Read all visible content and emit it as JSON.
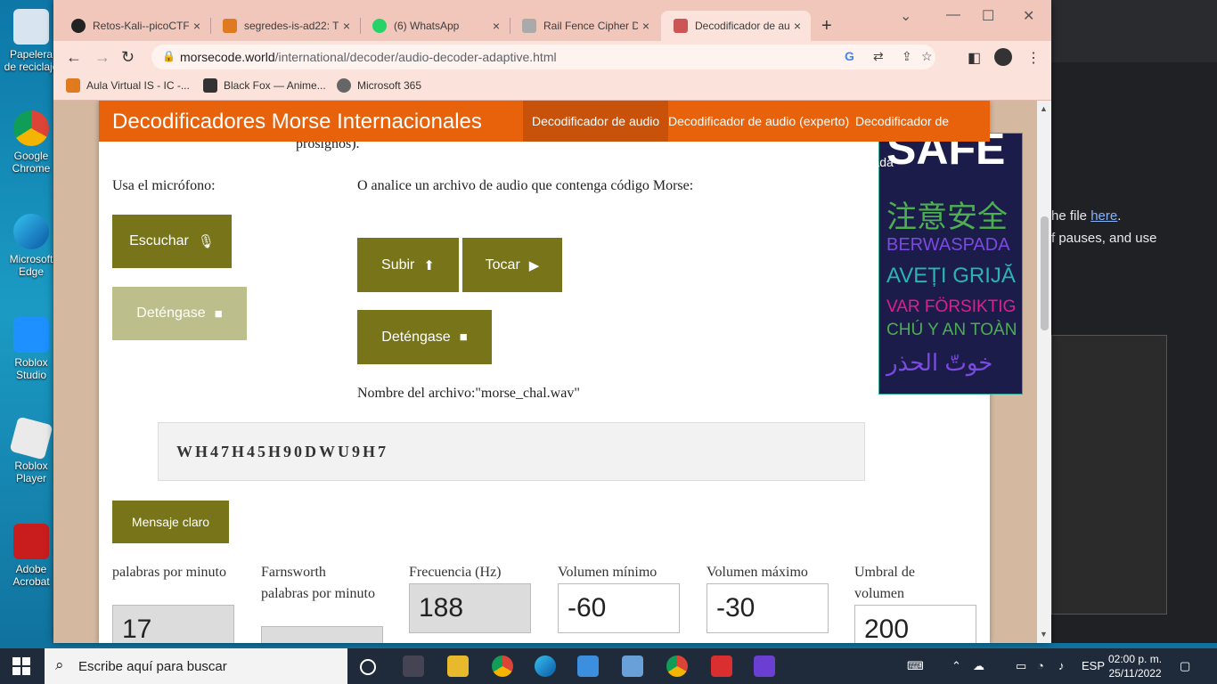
{
  "desktop": {
    "icons": [
      {
        "label": "Papelera de reciclaje"
      },
      {
        "label": "Google Chrome"
      },
      {
        "label": "Microsoft Edge"
      },
      {
        "label": "Roblox Studio"
      },
      {
        "label": "Roblox Player"
      },
      {
        "label": "Adobe Acrobat"
      }
    ]
  },
  "background_window": {
    "line1_prefix": "he file ",
    "line1_link": "here",
    "line1_suffix": ".",
    "line2": "f pauses, and use"
  },
  "browser": {
    "tabs": [
      {
        "title": "Retos-Kali--picoCTF",
        "close": "×"
      },
      {
        "title": "segredes-is-ad22: T",
        "close": "×"
      },
      {
        "title": "(6) WhatsApp",
        "close": "×"
      },
      {
        "title": "Rail Fence Cipher D",
        "close": "×"
      },
      {
        "title": "Decodificador de au",
        "close": "×"
      }
    ],
    "url_domain": "morsecode.world",
    "url_path": "/international/decoder/audio-decoder-adaptive.html",
    "bookmarks": [
      {
        "label": "Aula Virtual IS - IC -..."
      },
      {
        "label": "Black Fox — Anime..."
      },
      {
        "label": "Microsoft 365"
      }
    ]
  },
  "site": {
    "brand": "Decodificadores Morse Internacionales",
    "nav": [
      {
        "label": "Decodificador de audio"
      },
      {
        "label": "Decodificador de audio (experto)"
      },
      {
        "label": "Decodificador de mirada"
      }
    ],
    "partial_text": "prosignos).",
    "mic_label": "Usa el micrófono:",
    "listen_btn": "Escuchar",
    "stop_btn_left": "Deténgase",
    "file_label": "O analice un archivo de audio que contenga código Morse:",
    "upload_btn": "Subir",
    "play_btn": "Tocar",
    "stop_btn_right": "Deténgase",
    "filename_text": "Nombre del archivo:\"morse_chal.wav\"",
    "decoded": "WH47H45H90DWU9H7",
    "clear_btn": "Mensaje claro",
    "fields": [
      {
        "label": "palabras por minuto",
        "value": "17"
      },
      {
        "label": "Farnsworth palabras por minuto",
        "value": ""
      },
      {
        "label": "Frecuencia (Hz)",
        "value": "188"
      },
      {
        "label": "Volumen mínimo",
        "value": "-60"
      },
      {
        "label": "Volumen máximo",
        "value": "-30"
      },
      {
        "label": "Umbral de volumen",
        "value": "200"
      }
    ],
    "ad_lines": [
      {
        "text": "SAFE",
        "color": "#ffffff"
      },
      {
        "text": "注意安全",
        "color": "#4caf50"
      },
      {
        "text": "BERWASPADA",
        "color": "#7b4ae0"
      },
      {
        "text": "AVEȚI GRIJĂ",
        "color": "#2bb5b0"
      },
      {
        "text": "VAR FÖRSIKTIG",
        "color": "#e0208a"
      },
      {
        "text": "CHÚ Y AN TOÀN",
        "color": "#4caf50"
      },
      {
        "text": "خوتّ الحذر",
        "color": "#7b4ae0"
      }
    ]
  },
  "taskbar": {
    "search_placeholder": "Escribe aquí para buscar",
    "lang": "ESP",
    "time": "02:00 p. m.",
    "date": "25/11/2022"
  }
}
